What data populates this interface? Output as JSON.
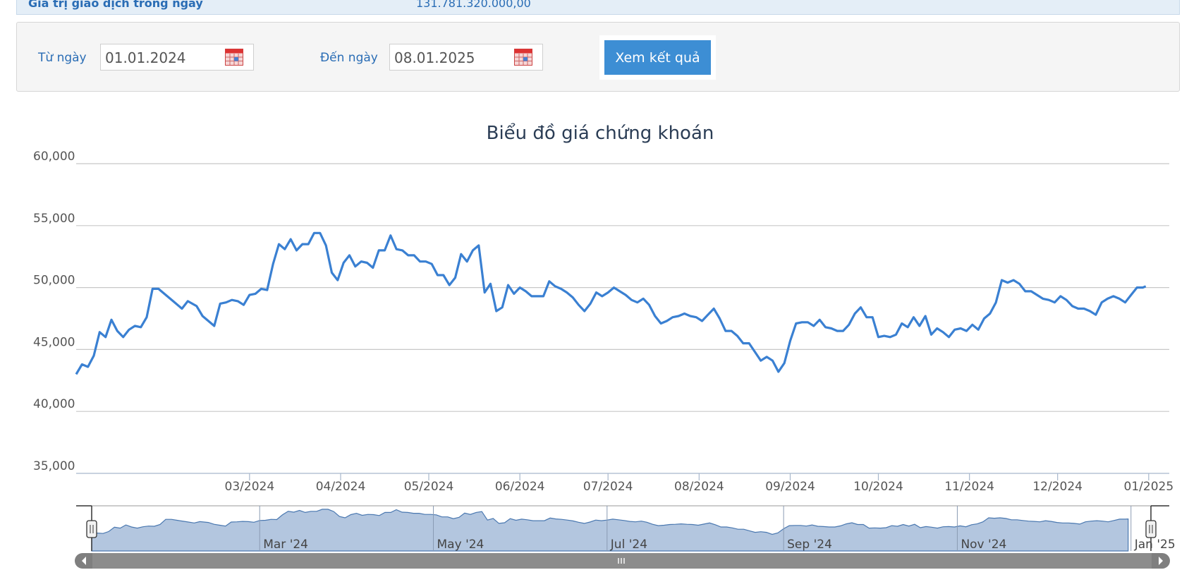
{
  "info": {
    "label": "Giá trị giao dịch trong ngày",
    "value": "131.781.320.000,00"
  },
  "filter": {
    "from_label": "Từ ngày",
    "from_value": "01.01.2024",
    "to_label": "Đến ngày",
    "to_value": "08.01.2025",
    "submit_label": "Xem kết quả"
  },
  "chart_data": {
    "type": "line",
    "title": "Biểu đồ giá chứng khoán",
    "ylim": [
      35000,
      60000
    ],
    "yticks": [
      "60,000",
      "55,000",
      "50,000",
      "45,000",
      "40,000",
      "35,000"
    ],
    "xticks": [
      {
        "label": "03/2024",
        "date": "2024-03-01"
      },
      {
        "label": "04/2024",
        "date": "2024-04-01"
      },
      {
        "label": "05/2024",
        "date": "2024-05-01"
      },
      {
        "label": "06/2024",
        "date": "2024-06-01"
      },
      {
        "label": "07/2024",
        "date": "2024-07-01"
      },
      {
        "label": "08/2024",
        "date": "2024-08-01"
      },
      {
        "label": "09/2024",
        "date": "2024-09-01"
      },
      {
        "label": "10/2024",
        "date": "2024-10-01"
      },
      {
        "label": "11/2024",
        "date": "2024-11-01"
      },
      {
        "label": "12/2024",
        "date": "2024-12-01"
      },
      {
        "label": "01/2025",
        "date": "2025-01-01"
      }
    ],
    "grid": true,
    "line_color": "#3a80d2",
    "series": [
      {
        "points": [
          [
            "2024-01-02",
            43000
          ],
          [
            "2024-01-04",
            43800
          ],
          [
            "2024-01-06",
            43600
          ],
          [
            "2024-01-08",
            44500
          ],
          [
            "2024-01-10",
            46400
          ],
          [
            "2024-01-12",
            46000
          ],
          [
            "2024-01-14",
            47400
          ],
          [
            "2024-01-16",
            46500
          ],
          [
            "2024-01-18",
            46000
          ],
          [
            "2024-01-20",
            46600
          ],
          [
            "2024-01-22",
            46900
          ],
          [
            "2024-01-24",
            46800
          ],
          [
            "2024-01-26",
            47600
          ],
          [
            "2024-01-28",
            49900
          ],
          [
            "2024-01-30",
            49900
          ],
          [
            "2024-02-01",
            49500
          ],
          [
            "2024-02-04",
            48900
          ],
          [
            "2024-02-07",
            48300
          ],
          [
            "2024-02-09",
            48900
          ],
          [
            "2024-02-12",
            48500
          ],
          [
            "2024-02-14",
            47700
          ],
          [
            "2024-02-16",
            47300
          ],
          [
            "2024-02-18",
            46900
          ],
          [
            "2024-02-20",
            48700
          ],
          [
            "2024-02-22",
            48800
          ],
          [
            "2024-02-24",
            49000
          ],
          [
            "2024-02-26",
            48900
          ],
          [
            "2024-02-28",
            48600
          ],
          [
            "2024-03-01",
            49400
          ],
          [
            "2024-03-03",
            49500
          ],
          [
            "2024-03-05",
            49900
          ],
          [
            "2024-03-07",
            49800
          ],
          [
            "2024-03-09",
            51900
          ],
          [
            "2024-03-11",
            53500
          ],
          [
            "2024-03-13",
            53100
          ],
          [
            "2024-03-15",
            53900
          ],
          [
            "2024-03-17",
            53000
          ],
          [
            "2024-03-19",
            53500
          ],
          [
            "2024-03-21",
            53500
          ],
          [
            "2024-03-23",
            54400
          ],
          [
            "2024-03-25",
            54400
          ],
          [
            "2024-03-27",
            53400
          ],
          [
            "2024-03-29",
            51200
          ],
          [
            "2024-03-31",
            50600
          ],
          [
            "2024-04-02",
            52000
          ],
          [
            "2024-04-04",
            52600
          ],
          [
            "2024-04-06",
            51700
          ],
          [
            "2024-04-08",
            52100
          ],
          [
            "2024-04-10",
            52000
          ],
          [
            "2024-04-12",
            51600
          ],
          [
            "2024-04-14",
            53000
          ],
          [
            "2024-04-16",
            53000
          ],
          [
            "2024-04-18",
            54200
          ],
          [
            "2024-04-20",
            53100
          ],
          [
            "2024-04-22",
            53000
          ],
          [
            "2024-04-24",
            52600
          ],
          [
            "2024-04-26",
            52600
          ],
          [
            "2024-04-28",
            52100
          ],
          [
            "2024-04-30",
            52100
          ],
          [
            "2024-05-02",
            51900
          ],
          [
            "2024-05-04",
            51000
          ],
          [
            "2024-05-06",
            51000
          ],
          [
            "2024-05-08",
            50200
          ],
          [
            "2024-05-10",
            50800
          ],
          [
            "2024-05-12",
            52700
          ],
          [
            "2024-05-14",
            52100
          ],
          [
            "2024-05-16",
            53000
          ],
          [
            "2024-05-18",
            53400
          ],
          [
            "2024-05-20",
            49600
          ],
          [
            "2024-05-22",
            50300
          ],
          [
            "2024-05-24",
            48100
          ],
          [
            "2024-05-26",
            48400
          ],
          [
            "2024-05-28",
            50200
          ],
          [
            "2024-05-30",
            49500
          ],
          [
            "2024-06-01",
            50000
          ],
          [
            "2024-06-03",
            49700
          ],
          [
            "2024-06-05",
            49300
          ],
          [
            "2024-06-07",
            49300
          ],
          [
            "2024-06-09",
            49300
          ],
          [
            "2024-06-11",
            50500
          ],
          [
            "2024-06-13",
            50100
          ],
          [
            "2024-06-15",
            49900
          ],
          [
            "2024-06-17",
            49600
          ],
          [
            "2024-06-19",
            49200
          ],
          [
            "2024-06-21",
            48600
          ],
          [
            "2024-06-23",
            48100
          ],
          [
            "2024-06-25",
            48700
          ],
          [
            "2024-06-27",
            49600
          ],
          [
            "2024-06-29",
            49300
          ],
          [
            "2024-07-01",
            49600
          ],
          [
            "2024-07-03",
            50000
          ],
          [
            "2024-07-05",
            49700
          ],
          [
            "2024-07-07",
            49400
          ],
          [
            "2024-07-09",
            49000
          ],
          [
            "2024-07-11",
            48800
          ],
          [
            "2024-07-13",
            49100
          ],
          [
            "2024-07-15",
            48600
          ],
          [
            "2024-07-17",
            47700
          ],
          [
            "2024-07-19",
            47100
          ],
          [
            "2024-07-21",
            47300
          ],
          [
            "2024-07-23",
            47600
          ],
          [
            "2024-07-25",
            47700
          ],
          [
            "2024-07-27",
            47900
          ],
          [
            "2024-07-29",
            47700
          ],
          [
            "2024-07-31",
            47600
          ],
          [
            "2024-08-02",
            47300
          ],
          [
            "2024-08-04",
            47800
          ],
          [
            "2024-08-06",
            48300
          ],
          [
            "2024-08-08",
            47500
          ],
          [
            "2024-08-10",
            46500
          ],
          [
            "2024-08-12",
            46500
          ],
          [
            "2024-08-14",
            46100
          ],
          [
            "2024-08-16",
            45500
          ],
          [
            "2024-08-18",
            45500
          ],
          [
            "2024-08-20",
            44800
          ],
          [
            "2024-08-22",
            44100
          ],
          [
            "2024-08-24",
            44400
          ],
          [
            "2024-08-26",
            44100
          ],
          [
            "2024-08-28",
            43200
          ],
          [
            "2024-08-30",
            43900
          ],
          [
            "2024-09-01",
            45700
          ],
          [
            "2024-09-03",
            47100
          ],
          [
            "2024-09-05",
            47200
          ],
          [
            "2024-09-07",
            47200
          ],
          [
            "2024-09-09",
            46900
          ],
          [
            "2024-09-11",
            47400
          ],
          [
            "2024-09-13",
            46800
          ],
          [
            "2024-09-15",
            46700
          ],
          [
            "2024-09-17",
            46500
          ],
          [
            "2024-09-19",
            46500
          ],
          [
            "2024-09-21",
            47000
          ],
          [
            "2024-09-23",
            47900
          ],
          [
            "2024-09-25",
            48400
          ],
          [
            "2024-09-27",
            47600
          ],
          [
            "2024-09-29",
            47600
          ],
          [
            "2024-10-01",
            46000
          ],
          [
            "2024-10-03",
            46100
          ],
          [
            "2024-10-05",
            46000
          ],
          [
            "2024-10-07",
            46200
          ],
          [
            "2024-10-09",
            47100
          ],
          [
            "2024-10-11",
            46800
          ],
          [
            "2024-10-13",
            47600
          ],
          [
            "2024-10-15",
            46900
          ],
          [
            "2024-10-17",
            47700
          ],
          [
            "2024-10-19",
            46200
          ],
          [
            "2024-10-21",
            46700
          ],
          [
            "2024-10-23",
            46400
          ],
          [
            "2024-10-25",
            46000
          ],
          [
            "2024-10-27",
            46600
          ],
          [
            "2024-10-29",
            46700
          ],
          [
            "2024-10-31",
            46500
          ],
          [
            "2024-11-02",
            47000
          ],
          [
            "2024-11-04",
            46600
          ],
          [
            "2024-11-06",
            47500
          ],
          [
            "2024-11-08",
            47900
          ],
          [
            "2024-11-10",
            48800
          ],
          [
            "2024-11-12",
            50600
          ],
          [
            "2024-11-14",
            50400
          ],
          [
            "2024-11-16",
            50600
          ],
          [
            "2024-11-18",
            50300
          ],
          [
            "2024-11-20",
            49700
          ],
          [
            "2024-11-22",
            49700
          ],
          [
            "2024-11-24",
            49400
          ],
          [
            "2024-11-26",
            49100
          ],
          [
            "2024-11-28",
            49000
          ],
          [
            "2024-11-30",
            48800
          ],
          [
            "2024-12-02",
            49300
          ],
          [
            "2024-12-04",
            49000
          ],
          [
            "2024-12-06",
            48500
          ],
          [
            "2024-12-08",
            48300
          ],
          [
            "2024-12-10",
            48300
          ],
          [
            "2024-12-12",
            48100
          ],
          [
            "2024-12-14",
            47800
          ],
          [
            "2024-12-16",
            48800
          ],
          [
            "2024-12-18",
            49100
          ],
          [
            "2024-12-20",
            49300
          ],
          [
            "2024-12-22",
            49100
          ],
          [
            "2024-12-24",
            48800
          ],
          [
            "2024-12-26",
            49400
          ],
          [
            "2024-12-28",
            50000
          ],
          [
            "2024-12-30",
            50000
          ],
          [
            "2024-12-31",
            50100
          ]
        ]
      }
    ],
    "navigator_labels": [
      "Mar '24",
      "May '24",
      "Jul '24",
      "Sep '24",
      "Nov '24",
      "Jan '25"
    ]
  }
}
